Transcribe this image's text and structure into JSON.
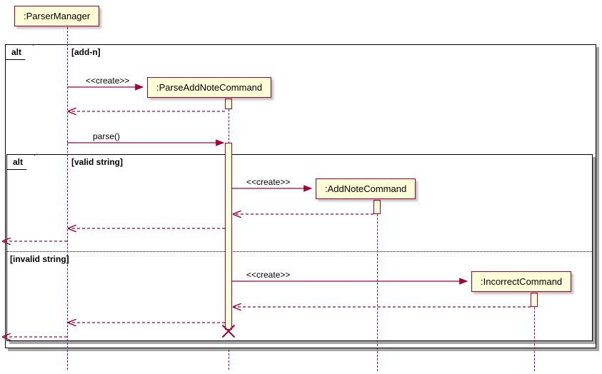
{
  "participants": {
    "parserManager": ":ParserManager",
    "parseAddNoteCommand": ":ParseAddNoteCommand",
    "addNoteCommand": ":AddNoteCommand",
    "incorrectCommand": ":IncorrectCommand"
  },
  "frames": {
    "outer": {
      "label": "alt",
      "guard": "[add-n]"
    },
    "inner": {
      "label": "alt",
      "guard_valid": "[valid string]",
      "guard_invalid": "[invalid string]"
    }
  },
  "messages": {
    "create1": "<<create>>",
    "parse": "parse()",
    "create2": "<<create>>",
    "create3": "<<create>>"
  },
  "chart_data": {
    "type": "sequence-diagram",
    "participants": [
      "ParserManager",
      "ParseAddNoteCommand",
      "AddNoteCommand",
      "IncorrectCommand"
    ],
    "fragments": [
      {
        "type": "alt",
        "operands": [
          {
            "guard": "add-n",
            "messages": [
              {
                "from": "ParserManager",
                "to": "ParseAddNoteCommand",
                "label": "<<create>>",
                "kind": "create"
              },
              {
                "from": "ParseAddNoteCommand",
                "to": "ParserManager",
                "kind": "return"
              },
              {
                "from": "ParserManager",
                "to": "ParseAddNoteCommand",
                "label": "parse()",
                "kind": "sync"
              },
              {
                "type": "alt",
                "operands": [
                  {
                    "guard": "valid string",
                    "messages": [
                      {
                        "from": "ParseAddNoteCommand",
                        "to": "AddNoteCommand",
                        "label": "<<create>>",
                        "kind": "create"
                      },
                      {
                        "from": "AddNoteCommand",
                        "to": "ParseAddNoteCommand",
                        "kind": "return"
                      },
                      {
                        "from": "ParseAddNoteCommand",
                        "to": "ParserManager",
                        "kind": "return"
                      },
                      {
                        "from": "ParserManager",
                        "to": "boundary",
                        "kind": "return"
                      }
                    ]
                  },
                  {
                    "guard": "invalid string",
                    "messages": [
                      {
                        "from": "ParseAddNoteCommand",
                        "to": "IncorrectCommand",
                        "label": "<<create>>",
                        "kind": "create"
                      },
                      {
                        "from": "IncorrectCommand",
                        "to": "ParseAddNoteCommand",
                        "kind": "return"
                      },
                      {
                        "from": "ParseAddNoteCommand",
                        "to": "ParserManager",
                        "kind": "return",
                        "note": "destroy ParseAddNoteCommand"
                      },
                      {
                        "from": "ParserManager",
                        "to": "boundary",
                        "kind": "return"
                      }
                    ]
                  }
                ]
              }
            ]
          }
        ]
      }
    ]
  }
}
